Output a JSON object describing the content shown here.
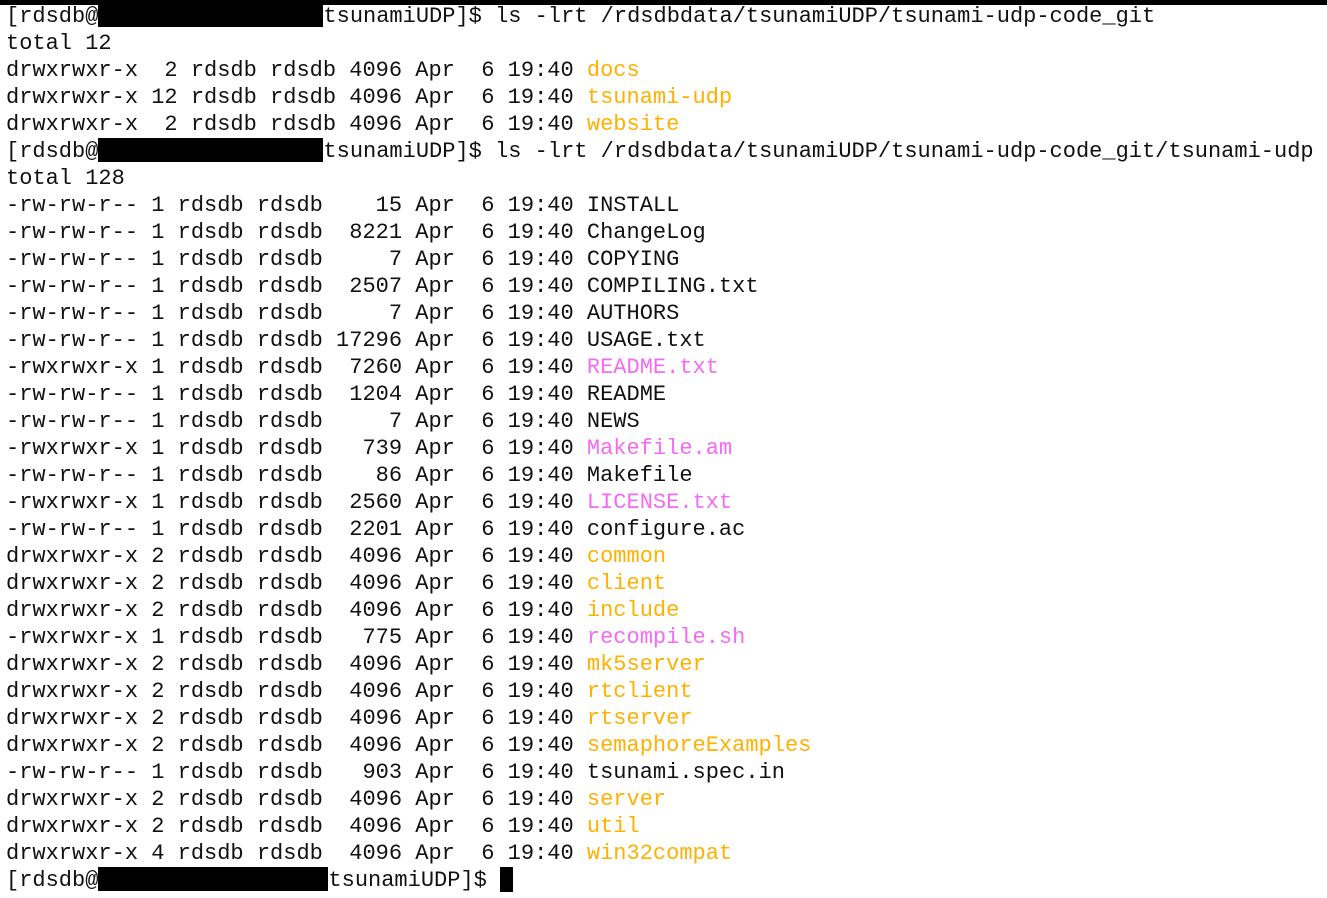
{
  "colors": {
    "directory": "#ffb000",
    "executable": "#f56af5",
    "regular": "#111111",
    "background": "#ffffff"
  },
  "prompt": {
    "prefix": "[rdsdb@",
    "suffix": "tsunamiUDP]$ "
  },
  "commands": {
    "first": "ls -lrt /rdsdbdata/tsunamiUDP/tsunami-udp-code_git",
    "second": "ls -lrt /rdsdbdata/tsunamiUDP/tsunami-udp-code_git/tsunami-udp"
  },
  "listing1": {
    "total": "total 12",
    "rows": [
      {
        "meta": "drwxrwxr-x  2 rdsdb rdsdb 4096 Apr  6 19:40 ",
        "name": "docs",
        "kind": "dir"
      },
      {
        "meta": "drwxrwxr-x 12 rdsdb rdsdb 4096 Apr  6 19:40 ",
        "name": "tsunami-udp",
        "kind": "dir"
      },
      {
        "meta": "drwxrwxr-x  2 rdsdb rdsdb 4096 Apr  6 19:40 ",
        "name": "website",
        "kind": "dir"
      }
    ]
  },
  "listing2": {
    "total": "total 128",
    "rows": [
      {
        "meta": "-rw-rw-r-- 1 rdsdb rdsdb    15 Apr  6 19:40 ",
        "name": "INSTALL",
        "kind": "file"
      },
      {
        "meta": "-rw-rw-r-- 1 rdsdb rdsdb  8221 Apr  6 19:40 ",
        "name": "ChangeLog",
        "kind": "file"
      },
      {
        "meta": "-rw-rw-r-- 1 rdsdb rdsdb     7 Apr  6 19:40 ",
        "name": "COPYING",
        "kind": "file"
      },
      {
        "meta": "-rw-rw-r-- 1 rdsdb rdsdb  2507 Apr  6 19:40 ",
        "name": "COMPILING.txt",
        "kind": "file"
      },
      {
        "meta": "-rw-rw-r-- 1 rdsdb rdsdb     7 Apr  6 19:40 ",
        "name": "AUTHORS",
        "kind": "file"
      },
      {
        "meta": "-rw-rw-r-- 1 rdsdb rdsdb 17296 Apr  6 19:40 ",
        "name": "USAGE.txt",
        "kind": "file"
      },
      {
        "meta": "-rwxrwxr-x 1 rdsdb rdsdb  7260 Apr  6 19:40 ",
        "name": "README.txt",
        "kind": "exec"
      },
      {
        "meta": "-rw-rw-r-- 1 rdsdb rdsdb  1204 Apr  6 19:40 ",
        "name": "README",
        "kind": "file"
      },
      {
        "meta": "-rw-rw-r-- 1 rdsdb rdsdb     7 Apr  6 19:40 ",
        "name": "NEWS",
        "kind": "file"
      },
      {
        "meta": "-rwxrwxr-x 1 rdsdb rdsdb   739 Apr  6 19:40 ",
        "name": "Makefile.am",
        "kind": "exec"
      },
      {
        "meta": "-rw-rw-r-- 1 rdsdb rdsdb    86 Apr  6 19:40 ",
        "name": "Makefile",
        "kind": "file"
      },
      {
        "meta": "-rwxrwxr-x 1 rdsdb rdsdb  2560 Apr  6 19:40 ",
        "name": "LICENSE.txt",
        "kind": "exec"
      },
      {
        "meta": "-rw-rw-r-- 1 rdsdb rdsdb  2201 Apr  6 19:40 ",
        "name": "configure.ac",
        "kind": "file"
      },
      {
        "meta": "drwxrwxr-x 2 rdsdb rdsdb  4096 Apr  6 19:40 ",
        "name": "common",
        "kind": "dir"
      },
      {
        "meta": "drwxrwxr-x 2 rdsdb rdsdb  4096 Apr  6 19:40 ",
        "name": "client",
        "kind": "dir"
      },
      {
        "meta": "drwxrwxr-x 2 rdsdb rdsdb  4096 Apr  6 19:40 ",
        "name": "include",
        "kind": "dir"
      },
      {
        "meta": "-rwxrwxr-x 1 rdsdb rdsdb   775 Apr  6 19:40 ",
        "name": "recompile.sh",
        "kind": "exec"
      },
      {
        "meta": "drwxrwxr-x 2 rdsdb rdsdb  4096 Apr  6 19:40 ",
        "name": "mk5server",
        "kind": "dir"
      },
      {
        "meta": "drwxrwxr-x 2 rdsdb rdsdb  4096 Apr  6 19:40 ",
        "name": "rtclient",
        "kind": "dir"
      },
      {
        "meta": "drwxrwxr-x 2 rdsdb rdsdb  4096 Apr  6 19:40 ",
        "name": "rtserver",
        "kind": "dir"
      },
      {
        "meta": "drwxrwxr-x 2 rdsdb rdsdb  4096 Apr  6 19:40 ",
        "name": "semaphoreExamples",
        "kind": "dir"
      },
      {
        "meta": "-rw-rw-r-- 1 rdsdb rdsdb   903 Apr  6 19:40 ",
        "name": "tsunami.spec.in",
        "kind": "file"
      },
      {
        "meta": "drwxrwxr-x 2 rdsdb rdsdb  4096 Apr  6 19:40 ",
        "name": "server",
        "kind": "dir"
      },
      {
        "meta": "drwxrwxr-x 2 rdsdb rdsdb  4096 Apr  6 19:40 ",
        "name": "util",
        "kind": "dir"
      },
      {
        "meta": "drwxrwxr-x 4 rdsdb rdsdb  4096 Apr  6 19:40 ",
        "name": "win32compat",
        "kind": "dir"
      }
    ]
  }
}
